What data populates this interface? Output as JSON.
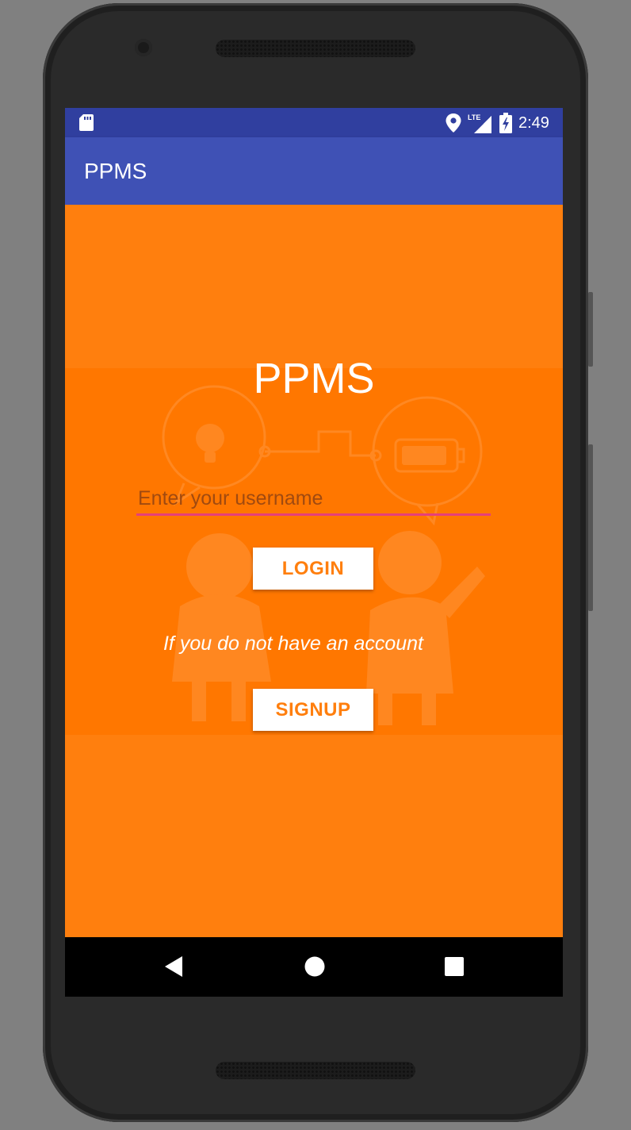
{
  "status_bar": {
    "time": "2:49",
    "network_label": "LTE",
    "icons": [
      "sd-card-icon",
      "location-icon",
      "signal-icon",
      "battery-charging-icon"
    ]
  },
  "app_bar": {
    "title": "PPMS"
  },
  "login": {
    "brand_title": "PPMS",
    "username": {
      "value": "",
      "placeholder": "Enter your username"
    },
    "login_button": "LOGIN",
    "hint": "If you do not have an account",
    "signup_button": "SIGNUP"
  },
  "nav_bar": {
    "icons": [
      "back-icon",
      "home-icon",
      "recents-icon"
    ]
  },
  "colors": {
    "status_bar": "#303f9f",
    "app_bar": "#3f51b5",
    "background": "#ff7f0e",
    "button_text": "#ff7f0e",
    "input_underline": "#e5407a"
  }
}
